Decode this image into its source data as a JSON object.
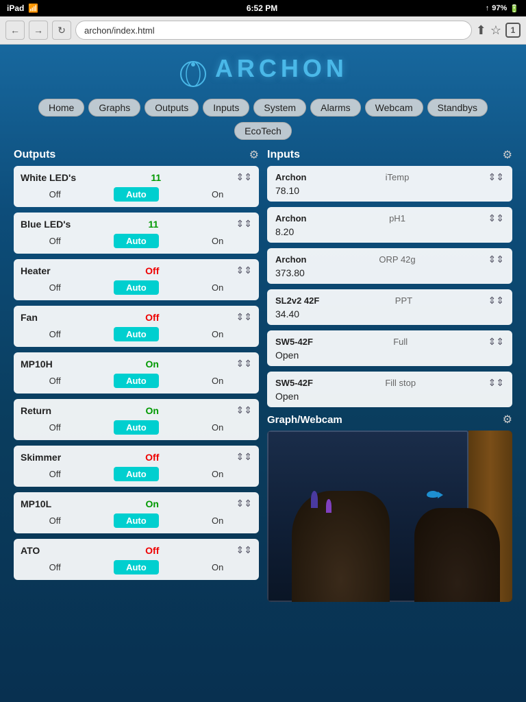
{
  "statusBar": {
    "left": "iPad",
    "wifi": "WiFi",
    "time": "6:52 PM",
    "signal": "▲",
    "battery": "97%"
  },
  "browser": {
    "url": "archon/index.html",
    "tabCount": "1"
  },
  "logo": {
    "text": "ARCHON"
  },
  "nav": {
    "items": [
      "Home",
      "Graphs",
      "Outputs",
      "Inputs",
      "System",
      "Alarms",
      "Webcam",
      "Standbys"
    ],
    "ecotech": "EcoTech"
  },
  "outputs": {
    "title": "Outputs",
    "gearLabel": "⚙",
    "items": [
      {
        "name": "White LED's",
        "status": "11",
        "statusType": "green",
        "off": "Off",
        "auto": "Auto",
        "on": "On"
      },
      {
        "name": "Blue LED's",
        "status": "11",
        "statusType": "green",
        "off": "Off",
        "auto": "Auto",
        "on": "On"
      },
      {
        "name": "Heater",
        "status": "Off",
        "statusType": "red",
        "off": "Off",
        "auto": "Auto",
        "on": "On"
      },
      {
        "name": "Fan",
        "status": "Off",
        "statusType": "red",
        "off": "Off",
        "auto": "Auto",
        "on": "On"
      },
      {
        "name": "MP10H",
        "status": "On",
        "statusType": "green",
        "off": "Off",
        "auto": "Auto",
        "on": "On"
      },
      {
        "name": "Return",
        "status": "On",
        "statusType": "green",
        "off": "Off",
        "auto": "Auto",
        "on": "On"
      },
      {
        "name": "Skimmer",
        "status": "Off",
        "statusType": "red",
        "off": "Off",
        "auto": "Auto",
        "on": "On"
      },
      {
        "name": "MP10L",
        "status": "On",
        "statusType": "green",
        "off": "Off",
        "auto": "Auto",
        "on": "On"
      },
      {
        "name": "ATO",
        "status": "Off",
        "statusType": "red",
        "off": "Off",
        "auto": "Auto",
        "on": "On"
      }
    ]
  },
  "inputs": {
    "title": "Inputs",
    "gearLabel": "⚙",
    "items": [
      {
        "source": "Archon",
        "name": "iTemp",
        "value": "78.10",
        "settings": "|||"
      },
      {
        "source": "Archon",
        "name": "pH1",
        "value": "8.20",
        "settings": "|||"
      },
      {
        "source": "Archon",
        "name": "ORP 42g",
        "value": "373.80",
        "settings": "|||"
      },
      {
        "source": "SL2v2 42F",
        "name": "PPT",
        "value": "34.40",
        "settings": "|||"
      },
      {
        "source": "SW5-42F",
        "name": "Full",
        "value": "Open",
        "settings": "|||"
      },
      {
        "source": "SW5-42F",
        "name": "Fill stop",
        "value": "Open",
        "settings": "|||"
      }
    ]
  },
  "webcam": {
    "title": "Graph/Webcam",
    "gearLabel": "⚙"
  }
}
